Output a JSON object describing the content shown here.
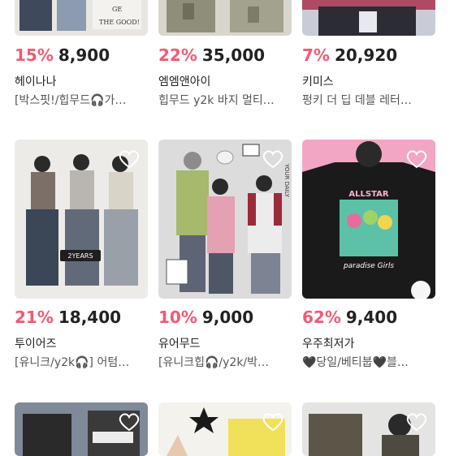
{
  "products": [
    {
      "discount": "15%",
      "price": "8,900",
      "shop": "헤이나나",
      "title": "[박스핏!/힙무드🎧가…"
    },
    {
      "discount": "22%",
      "price": "35,000",
      "shop": "엠엠앤아이",
      "title": "힙무드 y2k 바지 멀티…"
    },
    {
      "discount": "7%",
      "price": "20,920",
      "shop": "키미스",
      "title": "펑키 더 딥 데블 레터…"
    },
    {
      "discount": "21%",
      "price": "18,400",
      "shop": "투이어즈",
      "title": "[유니크/y2k🎧] 어텀…"
    },
    {
      "discount": "10%",
      "price": "9,000",
      "shop": "유어무드",
      "title": "[유니크힙🎧/y2k/박…"
    },
    {
      "discount": "62%",
      "price": "9,400",
      "shop": "우주최저가",
      "title": "🖤당일/베티붑🖤블…"
    }
  ],
  "thumb_text": {
    "top_left": [
      "GE",
      "THE GOOD!"
    ],
    "mid_left_badge": "2YEARS",
    "mid_center_side": "YOUR DAILY",
    "mid_right_shirt": [
      "ALLSTAR",
      "paradise Girls"
    ]
  },
  "colors": {
    "discount": "#f25a73",
    "text": "#222222",
    "subtext": "#555555"
  },
  "icons": [
    "heart-icon"
  ]
}
